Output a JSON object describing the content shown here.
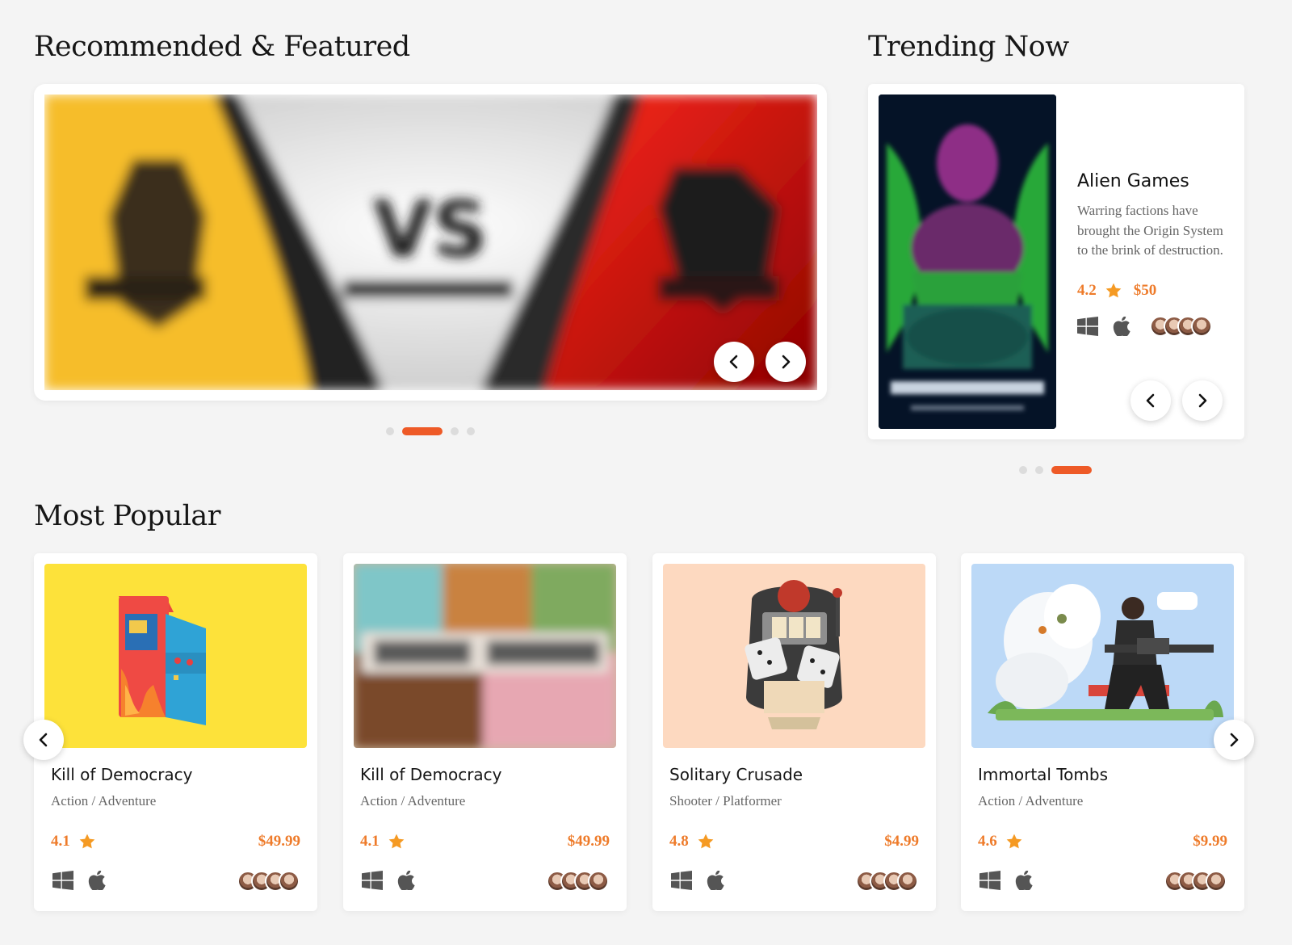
{
  "sections": {
    "featured_title": "Recommended & Featured",
    "trending_title": "Trending Now",
    "popular_title": "Most Popular"
  },
  "featured": {
    "banner_text": "VS",
    "active_slide": 2,
    "slide_count": 4
  },
  "trending": {
    "title": "Alien Games",
    "description": "Warring factions have brought the Origin System to the brink of destruction.",
    "rating": "4.2",
    "price": "$50",
    "active_slide": 3,
    "slide_count": 3
  },
  "popular": [
    {
      "title": "Kill of Democracy",
      "genre": "Action / Adventure",
      "rating": "4.1",
      "price": "$49.99"
    },
    {
      "title": "Kill of Democracy",
      "genre": "Action / Adventure",
      "rating": "4.1",
      "price": "$49.99"
    },
    {
      "title": "Solitary Crusade",
      "genre": "Shooter / Platformer",
      "rating": "4.8",
      "price": "$4.99"
    },
    {
      "title": "Immortal Tombs",
      "genre": "Action / Adventure",
      "rating": "4.6",
      "price": "$9.99"
    }
  ],
  "icons": {
    "prev": "chevron-left-icon",
    "next": "chevron-right-icon",
    "rating": "star-icon",
    "platforms": [
      "windows-icon",
      "apple-icon"
    ]
  },
  "colors": {
    "accent": "#ee5a27",
    "rating": "#ee7b2a",
    "background": "#f4f4f4"
  }
}
